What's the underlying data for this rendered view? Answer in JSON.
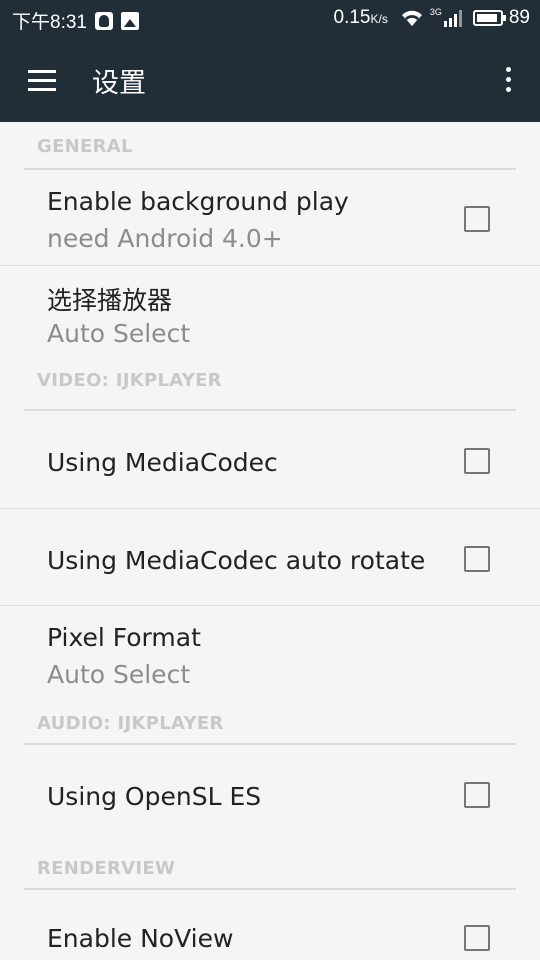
{
  "status_bar": {
    "time": "下午8:31",
    "net_speed": "0.15",
    "net_speed_unit": "K/s",
    "network_type": "3G",
    "battery": "89",
    "icons": [
      "qq-icon",
      "image-notification-icon",
      "wifi-icon",
      "signal-icon",
      "battery-icon"
    ]
  },
  "app_bar": {
    "title": "设置",
    "menu_icon": "hamburger-menu-icon",
    "more_icon": "more-vert-icon"
  },
  "sections": {
    "general": {
      "header": "GENERAL"
    },
    "video": {
      "header": "VIDEO: IJKPLAYER"
    },
    "audio": {
      "header": "AUDIO: IJKPLAYER"
    },
    "renderview": {
      "header": "RENDERVIEW"
    }
  },
  "prefs": {
    "background_play": {
      "title": "Enable background play",
      "summary": "need Android 4.0+",
      "checked": false
    },
    "player": {
      "title": "选择播放器",
      "summary": "Auto Select"
    },
    "mediacodec": {
      "title": "Using MediaCodec",
      "checked": false
    },
    "mediacodec_rotate": {
      "title": "Using MediaCodec auto rotate",
      "checked": false
    },
    "pixel_format": {
      "title": "Pixel Format",
      "summary": "Auto Select"
    },
    "opensl": {
      "title": "Using OpenSL ES",
      "checked": false
    },
    "noview": {
      "title": "Enable NoView",
      "checked": false
    }
  },
  "colors": {
    "app_bar_bg": "#212d37",
    "background": "#f5f5f5",
    "section_header": "#c8c8c8",
    "summary_text": "#8c8c8c"
  }
}
